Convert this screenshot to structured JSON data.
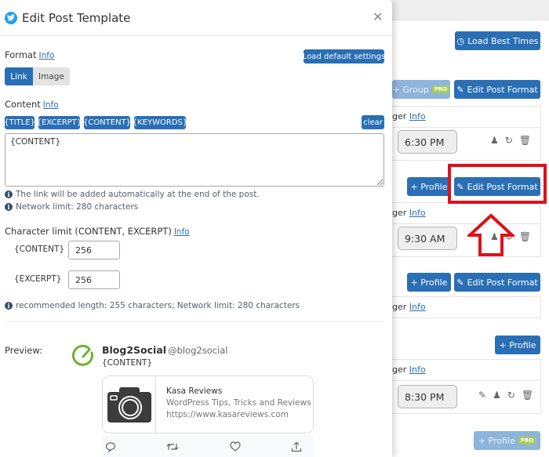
{
  "modal": {
    "title": "Edit Post Template",
    "network_icon": "twitter-icon",
    "close_icon": "close-icon",
    "format": {
      "label": "Format",
      "info": "Info",
      "load_default": "Load default settings",
      "options": [
        "Link",
        "Image"
      ],
      "selected": "Link"
    },
    "content": {
      "label": "Content",
      "info": "Info",
      "tags": [
        "{TITLE}",
        "{EXCERPT}",
        "{CONTENT}",
        "{KEYWORDS}"
      ],
      "clear": "clear",
      "value": "{CONTENT}",
      "notes": [
        "The link will be added automatically at the end of the post.",
        "Network limit: 280 characters"
      ]
    },
    "char_limit": {
      "label": "Character limit (CONTENT, EXCERPT)",
      "info": "Info",
      "fields": [
        {
          "label": "{CONTENT}",
          "value": "256"
        },
        {
          "label": "{EXCERPT}",
          "value": "256"
        }
      ],
      "note": "recommended length: 255 characters; Network limit: 280 characters"
    },
    "preview": {
      "label": "Preview:",
      "name": "Blog2Social",
      "handle": "@blog2social",
      "text": "{CONTENT}",
      "card": {
        "title": "Kasa Reviews",
        "description": "WordPress Tips, Tricks and Reviews",
        "url": "https://www.kasareviews.com"
      },
      "actions": [
        "reply-icon",
        "retweet-icon",
        "like-icon",
        "share-icon"
      ]
    }
  },
  "background": {
    "load_best_times": "Load Best Times",
    "group_label": "+ Group",
    "pro_badge": "PRO",
    "edit_post_format": "Edit Post Format",
    "add_profile": "+ Profile",
    "ger_text": "ger",
    "info": "Info",
    "times": [
      "6:30 PM",
      "9:30 AM",
      "8:30 PM"
    ]
  },
  "annotation": {
    "highlight_color": "#e0101b"
  },
  "colors": {
    "primary": "#2a6fb5",
    "twitter": "#1da1f2",
    "pro": "#a6cc5c",
    "blog2social_green": "#6ab42d"
  }
}
